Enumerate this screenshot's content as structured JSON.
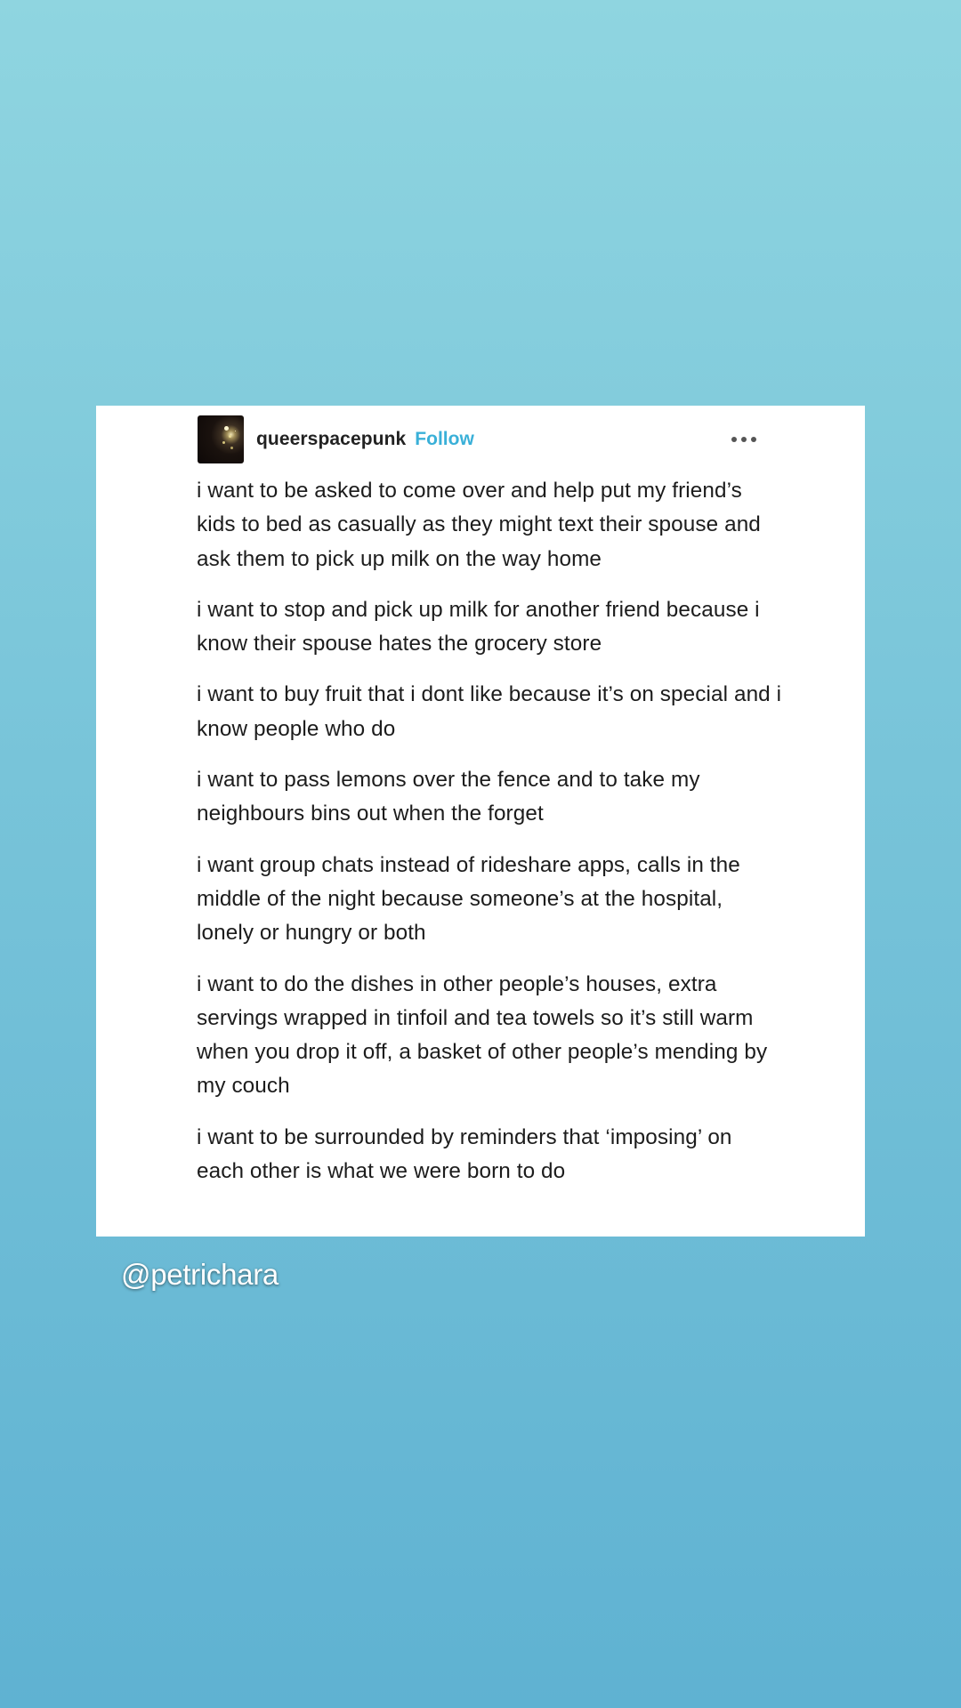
{
  "post": {
    "username": "queerspacepunk",
    "follow_label": "Follow",
    "more_icon": "more-horizontal-icon",
    "paragraphs": [
      "i want to be asked to come over and help put my friend’s kids to bed as casually as they might text their spouse and ask them to pick up milk on the way home",
      "i want to stop and pick up milk for another friend because i know their spouse hates the grocery store",
      "i want to buy fruit that i dont like because it’s on special and i know people who do",
      "i want to pass lemons over the fence and to take my neighbours bins out when the forget",
      "i want group chats instead of rideshare apps, calls in the middle of the night because someone’s at the hospital, lonely or hungry or both",
      "i want to do the dishes in other people’s houses, extra servings wrapped in tinfoil and tea towels so it’s still warm when you drop it off, a basket of other people’s mending by my couch",
      "i want to be surrounded by reminders that ‘imposing’ on each other is what we were born to do"
    ]
  },
  "credit": "@petrichara",
  "colors": {
    "background_top": "#8fd5e0",
    "background_bottom": "#5fb2d2",
    "follow_accent": "#3ab0d8",
    "card": "#ffffff"
  }
}
